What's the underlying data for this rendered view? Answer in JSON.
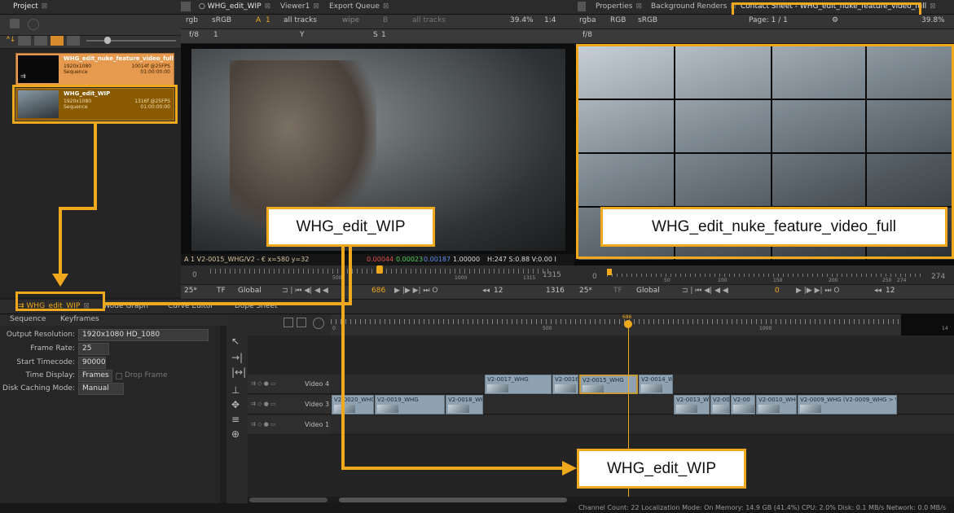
{
  "project": {
    "tab_label": "Project",
    "items": [
      {
        "name": "WHG_edit_nuke_feature_video_full",
        "res": "1920x1080",
        "frames": "10014f @25FPS",
        "type": "Sequence",
        "tc": "01:00:00:00"
      },
      {
        "name": "WHG_edit_WIP",
        "res": "1920x1080",
        "frames": "1316f @25FPS",
        "type": "Sequence",
        "tc": "01:00:00:00"
      }
    ]
  },
  "viewer_tabs": {
    "tab1": "WHG_edit_WIP",
    "tab2": "Viewer1",
    "tab3": "Export Queue"
  },
  "viewer_toolbar": {
    "channels": "rgb",
    "colorspace": "sRGB",
    "a_label": "A",
    "a_num": "1",
    "a_tracks": "all tracks",
    "wipe": "wipe",
    "b_label": "B",
    "b_tracks": "all tracks",
    "zoom": "39.4%",
    "ratio": "1:4",
    "fstop": "f/8",
    "one": "1",
    "y": "Y",
    "s": "S",
    "s1": "1"
  },
  "viewer_info": {
    "left": "A 1 V2-0015_WHG/V2 - € x=580 y=32",
    "r": "0.00044",
    "g": "0.00023",
    "b": "0.00187",
    "a": "1.00000",
    "hsv": "H:247 S:0.88 V:0.00 I"
  },
  "viewer_timeline": {
    "start": "0",
    "mid": "500",
    "mid2": "1000",
    "end": "1315",
    "end_box": "1315",
    "fps": "25*",
    "tf": "TF",
    "global": "Global",
    "frame": "686",
    "step": "12",
    "last": "1316"
  },
  "right_tabs": {
    "tab1": "Properties",
    "tab2": "Background Renders",
    "tab3": "Contact Sheet - WHG_edit_nuke_feature_video_full"
  },
  "right_toolbar": {
    "channels": "rgba",
    "space": "RGB",
    "colorspace": "sRGB",
    "page": "Page: 1 / 1",
    "zoom": "39.8%",
    "fstop": "f/8"
  },
  "right_timeline": {
    "start": "0",
    "t1": "50",
    "t2": "100",
    "t3": "150",
    "t4": "200",
    "t5": "250",
    "t6": "274",
    "end": "274",
    "fps": "25*",
    "tf": "TF",
    "global": "Global",
    "frame": "0",
    "step": "12"
  },
  "bottom_tabs": {
    "tab1": "WHG_edit_WIP",
    "tab2": "Node Graph",
    "tab3": "Curve Editor",
    "tab4": "Dope Sheet",
    "sub1": "Sequence",
    "sub2": "Keyframes"
  },
  "settings": {
    "output_resolution_label": "Output Resolution:",
    "output_resolution": "1920x1080 HD_1080",
    "frame_rate_label": "Frame Rate:",
    "frame_rate": "25",
    "start_timecode_label": "Start Timecode:",
    "start_timecode": "90000",
    "time_display_label": "Time Display:",
    "time_display": "Frames",
    "drop_frame": "Drop Frame",
    "disk_caching_label": "Disk Caching Mode:",
    "disk_caching": "Manual"
  },
  "timeline": {
    "ruler": {
      "r0": "0",
      "r500": "500",
      "r1000": "1000",
      "r14": "14",
      "playhead": "686"
    },
    "tracks": [
      {
        "name": "Video 4"
      },
      {
        "name": "Video 3"
      },
      {
        "name": "Video 1"
      }
    ],
    "v4_clips": [
      "V2-0017_WHG",
      "V2-0016_",
      "V2-0015_WHG",
      "V2-0014_WH"
    ],
    "v3_clips": [
      "V2-0020_WHG",
      "V2-0019_WHG",
      "V2-0018_WHG",
      "V2-0013_WH",
      "V2-001",
      "V2-00",
      "V2-0010_WHG",
      "V2-0009_WHG (V2-0009_WHG > V2)"
    ]
  },
  "status_bar": {
    "text": "Channel Count: 22  Localization Mode: On  Memory: 14.9 GB (41.4%)  CPU: 2.0%  Disk: 0.1 MB/s  Network: 0.0 MB/s"
  },
  "callouts": {
    "viewer": "WHG_edit_WIP",
    "contact": "WHG_edit_nuke_feature_video_full",
    "timeline": "WHG_edit_WIP"
  },
  "colors": {
    "accent": "#f0a81c",
    "selected_clip": "#8a5a00",
    "project_item_1": "#e69a50"
  }
}
